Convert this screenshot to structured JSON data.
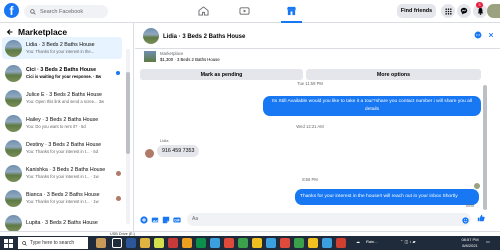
{
  "topbar": {
    "logo": "f",
    "search_placeholder": "Search Facebook",
    "find_friends": "Find friends",
    "notification_count": "3"
  },
  "sidebar": {
    "title": "Marketplace",
    "conversations": [
      {
        "title": "Lidia · 3 Beds 2 Baths House",
        "preview": "You: Thanks for your interest in the...",
        "unread": false
      },
      {
        "title": "Cici · 3 Beds 2 Baths House",
        "preview": "Cici is waiting for your response. · 8w",
        "unread": true
      },
      {
        "title": "Julice E · 3 Beds 2 Baths House",
        "preview": "You: Open this link and send a scree... 3w",
        "unread": false
      },
      {
        "title": "Hailey · 3 Beds 2 Baths House",
        "preview": "You: Do you want to rent it? · 5d",
        "unread": false
      },
      {
        "title": "Destiny · 3 Beds 2 Baths House",
        "preview": "You: Thanks for your interest in t... · 5d",
        "unread": false
      },
      {
        "title": "Kanishka · 3 Beds 2 Baths House",
        "preview": "You: Thanks for your interest in t... · 1w",
        "unread": false
      },
      {
        "title": "Bianca · 3 Beds 2 Baths House",
        "preview": "You: Thanks for your interest in t... · 1w",
        "unread": false
      },
      {
        "title": "Lupita · 3 Beds 2 Baths House",
        "preview": "",
        "unread": false
      }
    ]
  },
  "chat": {
    "title": "Lidia · 3 Beds 2 Baths House",
    "listing_source": "Marketplace",
    "listing_price": "$1,300 · 3 Beds 2 Baths House",
    "mark_pending": "Mark as pending",
    "more_options": "More options",
    "ts1": "Tue 11:59 PM",
    "msg_out_1": "Its Still Available would you like to take it a tour?share you contact number i will share you all details",
    "ts2": "Wed 12:21 AM",
    "sender_name": "Lidia",
    "msg_in_1": "916 459 7353",
    "ts3": "8:56 PM",
    "msg_out_2": "Thanks for your interest in the house!I will reach out in your inbox Shortly",
    "sent_label": "Sent",
    "composer_placeholder": "Aa"
  },
  "downloads": {
    "item": "USB Drive (E:)"
  },
  "taskbar": {
    "search_placeholder": "Type here to search",
    "weather": "Rain...",
    "time": "08:57 PM",
    "date": "6/8/2021"
  }
}
